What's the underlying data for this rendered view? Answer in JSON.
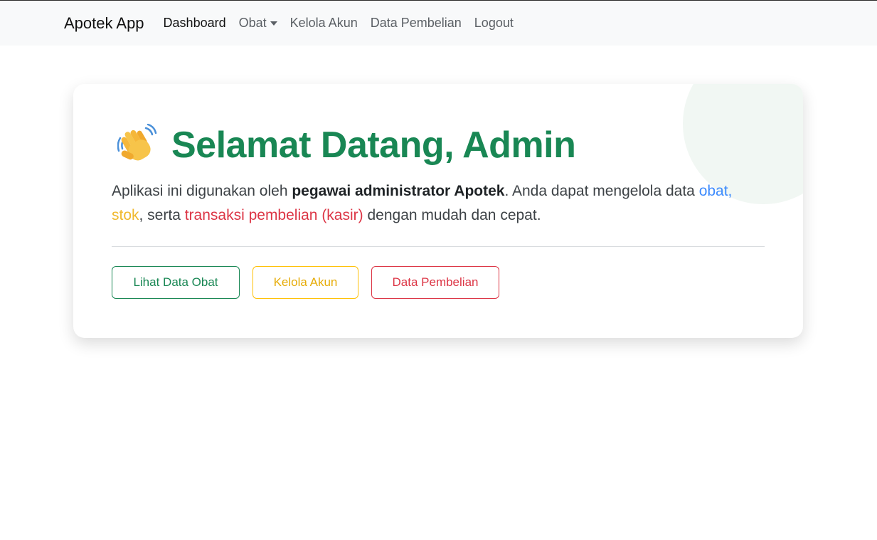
{
  "navbar": {
    "brand": "Apotek App",
    "items": [
      {
        "label": "Dashboard"
      },
      {
        "label": "Obat"
      },
      {
        "label": "Kelola Akun"
      },
      {
        "label": "Data Pembelian"
      },
      {
        "label": "Logout"
      }
    ]
  },
  "welcome": {
    "icon": "waving-hand-icon",
    "title": "Selamat Datang, Admin",
    "intro_1": "Aplikasi ini digunakan oleh ",
    "intro_bold": "pegawai administrator Apotek",
    "intro_2": ". Anda dapat mengelola data ",
    "link_obat": "obat,",
    "link_stok": "stok",
    "intro_3": ", serta ",
    "link_transaksi": "transaksi pembelian (kasir)",
    "intro_4": " dengan mudah dan cepat."
  },
  "actions": {
    "lihat_obat": "Lihat Data Obat",
    "kelola_akun": "Kelola Akun",
    "data_pembelian": "Data Pembelian"
  },
  "colors": {
    "primary_green": "#198754",
    "warning_yellow": "#ffc107",
    "danger_red": "#dc3545",
    "info_blue": "#3d8bfd",
    "navbar_bg": "#f8f9fa"
  }
}
